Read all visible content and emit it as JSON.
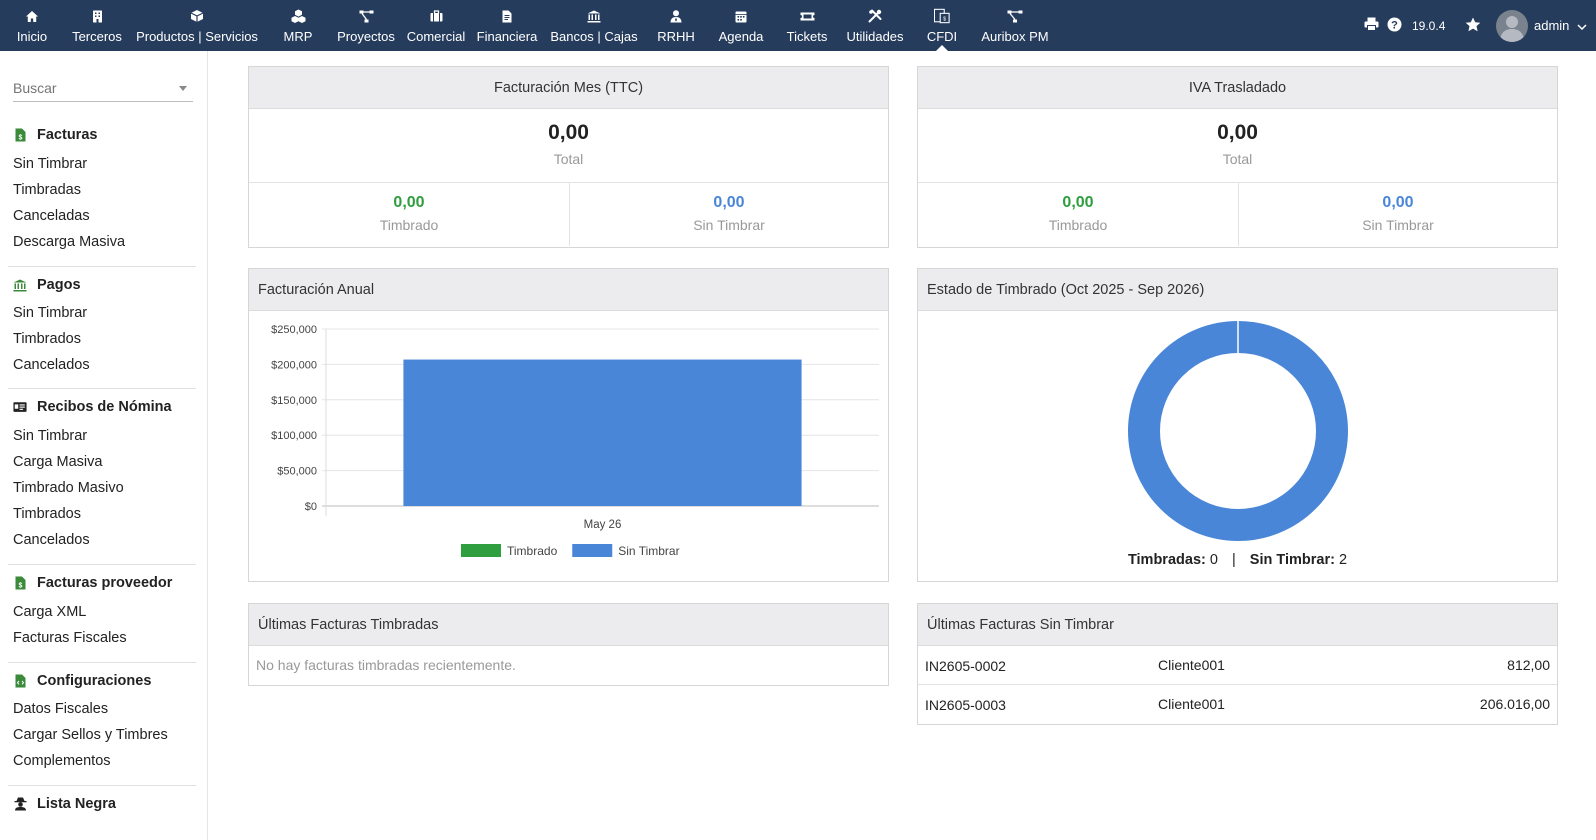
{
  "topbar": {
    "menu": [
      {
        "label": "Inicio",
        "icon": "home-icon"
      },
      {
        "label": "Terceros",
        "icon": "building-icon"
      },
      {
        "label": "Productos | Servicios",
        "icon": "cube-icon"
      },
      {
        "label": "MRP",
        "icon": "cubes-icon"
      },
      {
        "label": "Proyectos",
        "icon": "sitemap-icon"
      },
      {
        "label": "Comercial",
        "icon": "suitcase-icon"
      },
      {
        "label": "Financiera",
        "icon": "invoice-icon"
      },
      {
        "label": "Bancos | Cajas",
        "icon": "bank-icon"
      },
      {
        "label": "RRHH",
        "icon": "user-tie-icon"
      },
      {
        "label": "Agenda",
        "icon": "calendar-icon"
      },
      {
        "label": "Tickets",
        "icon": "ticket-icon"
      },
      {
        "label": "Utilidades",
        "icon": "tools-icon"
      },
      {
        "label": "CFDI",
        "icon": "cfdi-icon"
      },
      {
        "label": "Auribox PM",
        "icon": "network-icon"
      }
    ],
    "version": "19.0.4",
    "user": "admin"
  },
  "sidebar": {
    "search_placeholder": "Buscar",
    "sections": [
      {
        "title": "Facturas",
        "icon": "invoice-dollar-icon",
        "items": [
          "Sin Timbrar",
          "Timbradas",
          "Canceladas",
          "Descarga Masiva"
        ]
      },
      {
        "title": "Pagos",
        "icon": "bank-icon",
        "items": [
          "Sin Timbrar",
          "Timbrados",
          "Cancelados"
        ]
      },
      {
        "title": "Recibos de Nómina",
        "icon": "id-card-icon",
        "items": [
          "Sin Timbrar",
          "Carga Masiva",
          "Timbrado Masivo",
          "Timbrados",
          "Cancelados"
        ]
      },
      {
        "title": "Facturas proveedor",
        "icon": "invoice-dollar-icon",
        "items": [
          "Carga XML",
          "Facturas Fiscales"
        ]
      },
      {
        "title": "Configuraciones",
        "icon": "file-code-icon",
        "items": [
          "Datos Fiscales",
          "Cargar Sellos y Timbres",
          "Complementos"
        ]
      },
      {
        "title": "Lista Negra",
        "icon": "user-secret-icon",
        "items": []
      }
    ]
  },
  "facturacion_mes": {
    "title": "Facturación Mes (TTC)",
    "total": "0,00",
    "total_label": "Total",
    "timbrado": "0,00",
    "timbrado_label": "Timbrado",
    "sin_timbrar": "0,00",
    "sin_timbrar_label": "Sin Timbrar"
  },
  "iva": {
    "title": "IVA Trasladado",
    "total": "0,00",
    "total_label": "Total",
    "timbrado": "0,00",
    "timbrado_label": "Timbrado",
    "sin_timbrar": "0,00",
    "sin_timbrar_label": "Sin Timbrar"
  },
  "annual": {
    "title": "Facturación Anual"
  },
  "estado": {
    "title": "Estado de Timbrado (Oct 2025 - Sep 2026)",
    "timbradas_label": "Timbradas:",
    "timbradas_value": "0",
    "separator": "|",
    "sin_timbrar_label": "Sin Timbrar:",
    "sin_timbrar_value": "2"
  },
  "ultimas_timbradas": {
    "title": "Últimas Facturas Timbradas",
    "empty": "No hay facturas timbradas recientemente."
  },
  "ultimas_sin_timbrar": {
    "title": "Últimas Facturas Sin Timbrar",
    "rows": [
      {
        "ref": "IN2605-0002",
        "client": "Cliente001",
        "amount": "812,00"
      },
      {
        "ref": "IN2605-0003",
        "client": "Cliente001",
        "amount": "206.016,00"
      }
    ]
  },
  "colors": {
    "topbar": "#263c5c",
    "timbrado": "#2e9e3e",
    "sin_timbrar": "#4a86d8",
    "sidebar_icon": "#3a8a3a"
  },
  "chart_data": [
    {
      "type": "bar",
      "categories": [
        "May 26"
      ],
      "series": [
        {
          "name": "Timbrado",
          "values": [
            0
          ],
          "color": "#2e9e3e"
        },
        {
          "name": "Sin Timbrar",
          "values": [
            206828
          ],
          "color": "#4a86d8"
        }
      ],
      "ylim": [
        0,
        250000
      ],
      "yticks": [
        "$0",
        "$50,000",
        "$100,000",
        "$150,000",
        "$200,000",
        "$250,000"
      ],
      "grid": true,
      "legend": "bottom"
    },
    {
      "type": "pie",
      "donut": true,
      "labels": [
        "Timbradas",
        "Sin Timbrar"
      ],
      "values": [
        0,
        2
      ],
      "colors": [
        "#2e9e3e",
        "#4a86d8"
      ]
    }
  ]
}
